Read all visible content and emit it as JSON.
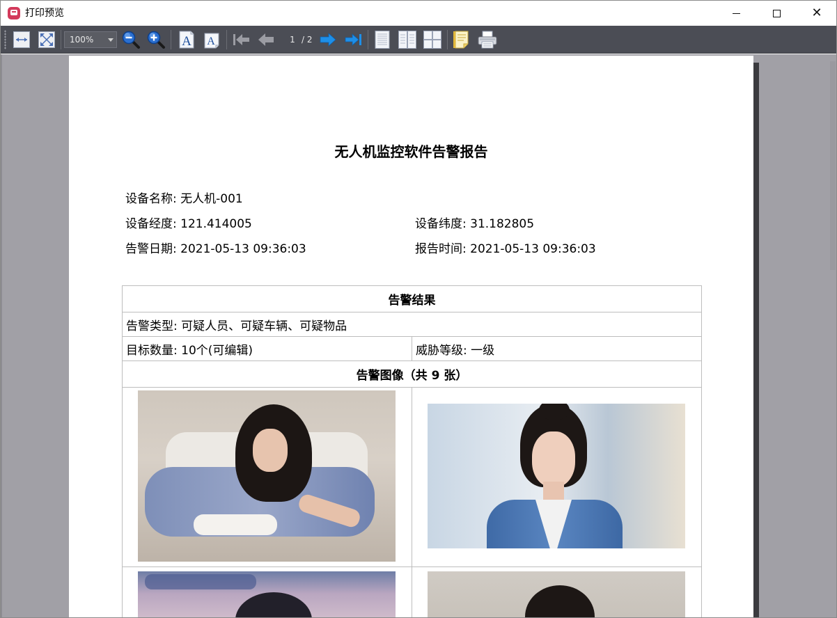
{
  "window": {
    "title": "打印预览",
    "buttons": {
      "minimize": "minimize",
      "maximize": "maximize",
      "close": "✕"
    }
  },
  "toolbar": {
    "zoom_value": "100%",
    "current_page": "1",
    "total_pages": "/ 2",
    "icons": [
      "fit-width-icon",
      "fit-page-icon",
      "zoom-out-icon",
      "zoom-in-icon",
      "font-larger-icon",
      "font-smaller-icon",
      "first-page-icon",
      "prev-page-icon",
      "next-page-icon",
      "last-page-icon",
      "single-page-icon",
      "two-page-icon",
      "four-page-icon",
      "page-setup-icon",
      "print-icon"
    ]
  },
  "report": {
    "title": "无人机监控软件告警报告",
    "device_name": "设备名称: 无人机-001",
    "longitude": "设备经度: 121.414005",
    "latitude": "设备纬度: 31.182805",
    "alarm_date": "告警日期: 2021-05-13 09:36:03",
    "report_time": "报告时间: 2021-05-13 09:36:03",
    "table": {
      "result_header": "告警结果",
      "alarm_type": "告警类型: 可疑人员、可疑车辆、可疑物品",
      "target_count": "目标数量: 10个(可编辑)",
      "threat_level": "威胁等级: 一级",
      "images_header": "告警图像（共 9 张）"
    }
  },
  "colors": {
    "toolbar_bg": "#4b4d55",
    "preview_bg": "#a1a0a6",
    "accent_blue": "#1e8fe8",
    "app_icon": "#d33a5b"
  }
}
